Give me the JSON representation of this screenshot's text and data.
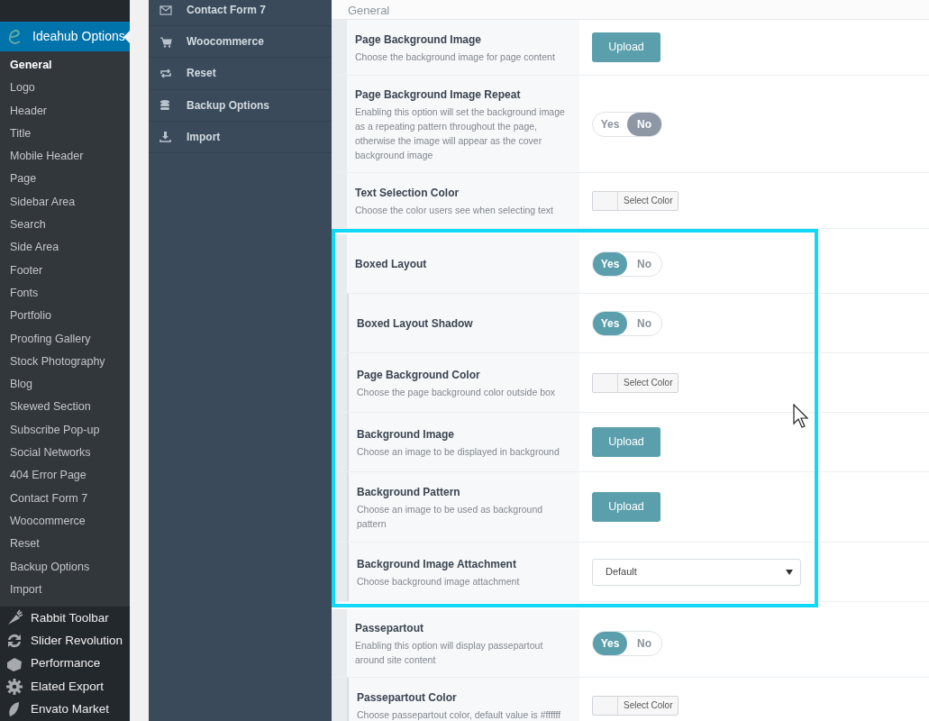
{
  "admin_menu": {
    "header": {
      "label": "Ideahub Options",
      "selected": true
    },
    "submenu": [
      {
        "label": "General",
        "selected": true
      },
      {
        "label": "Logo",
        "selected": false
      },
      {
        "label": "Header",
        "selected": false
      },
      {
        "label": "Title",
        "selected": false
      },
      {
        "label": "Mobile Header",
        "selected": false
      },
      {
        "label": "Page",
        "selected": false
      },
      {
        "label": "Sidebar Area",
        "selected": false
      },
      {
        "label": "Search",
        "selected": false
      },
      {
        "label": "Side Area",
        "selected": false
      },
      {
        "label": "Footer",
        "selected": false
      },
      {
        "label": "Fonts",
        "selected": false
      },
      {
        "label": "Portfolio",
        "selected": false
      },
      {
        "label": "Proofing Gallery",
        "selected": false
      },
      {
        "label": "Stock Photography",
        "selected": false
      },
      {
        "label": "Blog",
        "selected": false
      },
      {
        "label": "Skewed Section",
        "selected": false
      },
      {
        "label": "Subscribe Pop-up",
        "selected": false
      },
      {
        "label": "Social Networks",
        "selected": false
      },
      {
        "label": "404 Error Page",
        "selected": false
      },
      {
        "label": "Contact Form 7",
        "selected": false
      },
      {
        "label": "Woocommerce",
        "selected": false
      },
      {
        "label": "Reset",
        "selected": false
      },
      {
        "label": "Backup Options",
        "selected": false
      },
      {
        "label": "Import",
        "selected": false
      }
    ],
    "items": [
      {
        "label": "Rabbit Toolbar"
      },
      {
        "label": "Slider Revolution"
      },
      {
        "label": "Performance"
      },
      {
        "label": "Elated Export"
      },
      {
        "label": "Envato Market"
      }
    ]
  },
  "options_nav": [
    {
      "label": "Contact Form 7"
    },
    {
      "label": "Woocommerce"
    },
    {
      "label": "Reset"
    },
    {
      "label": "Backup Options"
    },
    {
      "label": "Import"
    }
  ],
  "section_title": "General",
  "option_groups": [
    {
      "framed": false,
      "rows": [
        {
          "kind": "upload",
          "nested": false,
          "title": "Page Background Image",
          "description": "Choose the background image for page content",
          "button": "Upload"
        },
        {
          "kind": "toggle",
          "nested": false,
          "title": "Page Background Image Repeat",
          "description": "Enabling this option will set the background image as a repeating pattern throughout the page, otherwise the image will appear as the cover background image",
          "choices": [
            {
              "label": "Yes",
              "selected": false
            },
            {
              "label": "No",
              "selected": true
            }
          ]
        },
        {
          "kind": "color",
          "nested": false,
          "title": "Text Selection Color",
          "description": "Choose the color users see when selecting text",
          "button": "Select Color"
        }
      ]
    },
    {
      "framed": true,
      "rows": [
        {
          "kind": "toggle",
          "nested": false,
          "title": "Boxed Layout",
          "choices": [
            {
              "label": "Yes",
              "selected": true
            },
            {
              "label": "No",
              "selected": false
            }
          ]
        },
        {
          "kind": "toggle",
          "nested": true,
          "title": "Boxed Layout Shadow",
          "choices": [
            {
              "label": "Yes",
              "selected": true
            },
            {
              "label": "No",
              "selected": false
            }
          ]
        },
        {
          "kind": "color",
          "nested": true,
          "title": "Page Background Color",
          "description": "Choose the page background color outside box",
          "button": "Select Color"
        },
        {
          "kind": "upload",
          "nested": true,
          "title": "Background Image",
          "description": "Choose an image to be displayed in background",
          "button": "Upload"
        },
        {
          "kind": "upload",
          "nested": true,
          "title": "Background Pattern",
          "description": "Choose an image to be used as background pattern",
          "button": "Upload"
        },
        {
          "kind": "select",
          "nested": true,
          "title": "Background Image Attachment",
          "description": "Choose background image attachment",
          "value": "Default"
        }
      ]
    },
    {
      "framed": false,
      "rows": [
        {
          "kind": "toggle",
          "nested": false,
          "title": "Passepartout",
          "description": "Enabling this option will display passepartout around site content",
          "choices": [
            {
              "label": "Yes",
              "selected": true
            },
            {
              "label": "No",
              "selected": false
            }
          ]
        },
        {
          "kind": "color",
          "nested": true,
          "title": "Passepartout Color",
          "description": "Choose passepartout color, default value is #ffffff",
          "button": "Select Color"
        }
      ]
    }
  ]
}
